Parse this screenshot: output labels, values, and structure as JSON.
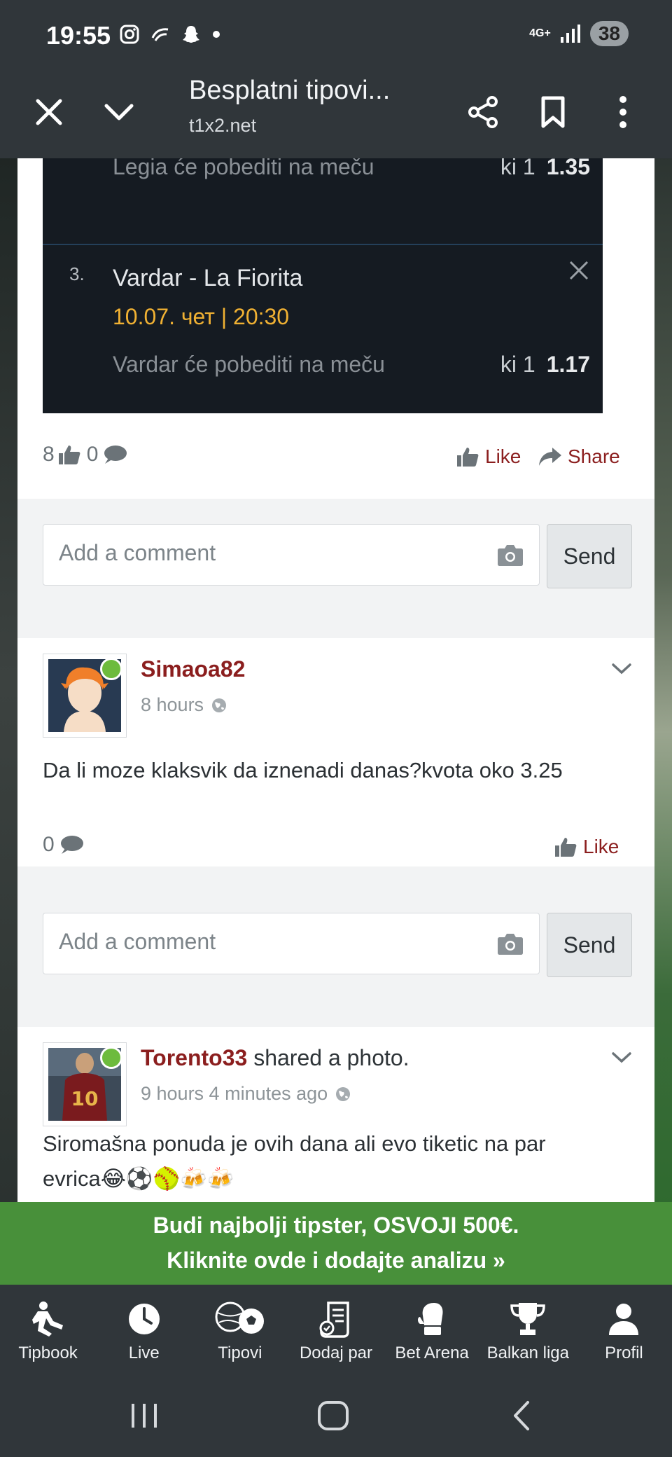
{
  "status_bar": {
    "time": "19:55",
    "network": "4G+",
    "battery": "38"
  },
  "browser": {
    "title": "Besplatni tipovi...",
    "url": "t1x2.net"
  },
  "ticket": {
    "prev_prediction": "Legia će pobediti na meču",
    "prev_odds_type": "ki 1",
    "prev_odds_value": "1.35",
    "row_number": "3.",
    "match": "Vardar - La Fiorita",
    "date": "10.07. чет | 20:30",
    "prediction": "Vardar će pobediti na meču",
    "odds_type": "ki 1",
    "odds_value": "1.17"
  },
  "post1_meta": {
    "likes": "8",
    "comments": "0",
    "like_label": "Like",
    "share_label": "Share"
  },
  "comment_box": {
    "placeholder": "Add a comment",
    "send_label": "Send"
  },
  "post2": {
    "username": "Simaoa82",
    "time": "8 hours",
    "text": "Da li moze klaksvik da iznenadi danas?kvota oko 3.25",
    "comments": "0",
    "like_label": "Like"
  },
  "post3": {
    "username": "Torento33",
    "action": " shared a photo.",
    "time": "9 hours 4 minutes ago",
    "text_line1": "Siromašna ponuda je ovih dana ali evo tiketic na par",
    "text_line2": "evrica😂⚽🥎🍻🍻"
  },
  "promo": {
    "line1": "Budi najbolji tipster, OSVOJI 500€.",
    "line2": "Kliknite ovde i dodajte analizu »"
  },
  "bottom_nav": {
    "items": [
      {
        "label": "Tipbook",
        "icon": "player-icon"
      },
      {
        "label": "Live",
        "icon": "clock-icon"
      },
      {
        "label": "Tipovi",
        "icon": "balls-icon"
      },
      {
        "label": "Dodaj par",
        "icon": "ticket-icon"
      },
      {
        "label": "Bet Arena",
        "icon": "glove-icon"
      },
      {
        "label": "Balkan liga",
        "icon": "trophy-icon"
      },
      {
        "label": "Profil",
        "icon": "user-icon"
      }
    ]
  },
  "colors": {
    "accent": "#8b1e1e",
    "promo": "#48903a",
    "dark_bar": "#30363a",
    "ticket_bg": "#151b22",
    "date": "#f0b133"
  }
}
